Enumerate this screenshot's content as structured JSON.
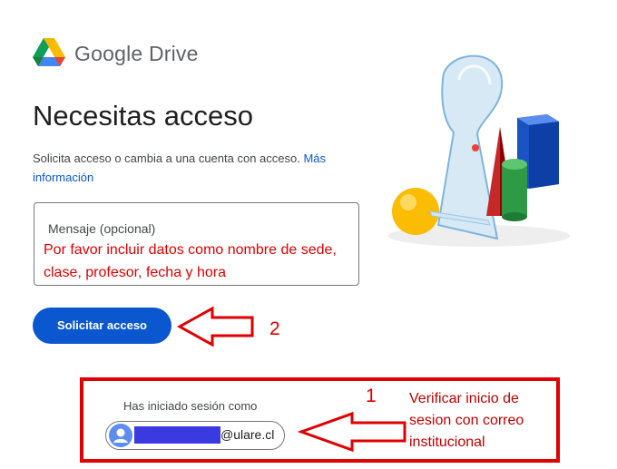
{
  "header": {
    "brand": "Google Drive",
    "logo_icon": "google-drive-logo-icon"
  },
  "main": {
    "title": "Necesitas acceso",
    "description": "Solicita acceso o cambia a una cuenta con acceso. ",
    "more_info_link": "Más información",
    "message": {
      "label": "Mensaje (opcional)",
      "value": "Por favor incluir datos como nombre de sede, clase, profesor, fecha y hora"
    },
    "request_button": "Solicitar acceso"
  },
  "account": {
    "signed_in_label": "Has iniciado sesión como",
    "email_suffix": "@ulare.cl",
    "avatar_icon": "account-circle-icon"
  },
  "annotations": {
    "step_2": "2",
    "step_1": "1",
    "step_1_note": "Verificar inicio de sesion con correo institucional",
    "color": "#e00000"
  },
  "colors": {
    "primary_blue": "#0b57d0",
    "annotation_red": "#e00000"
  }
}
